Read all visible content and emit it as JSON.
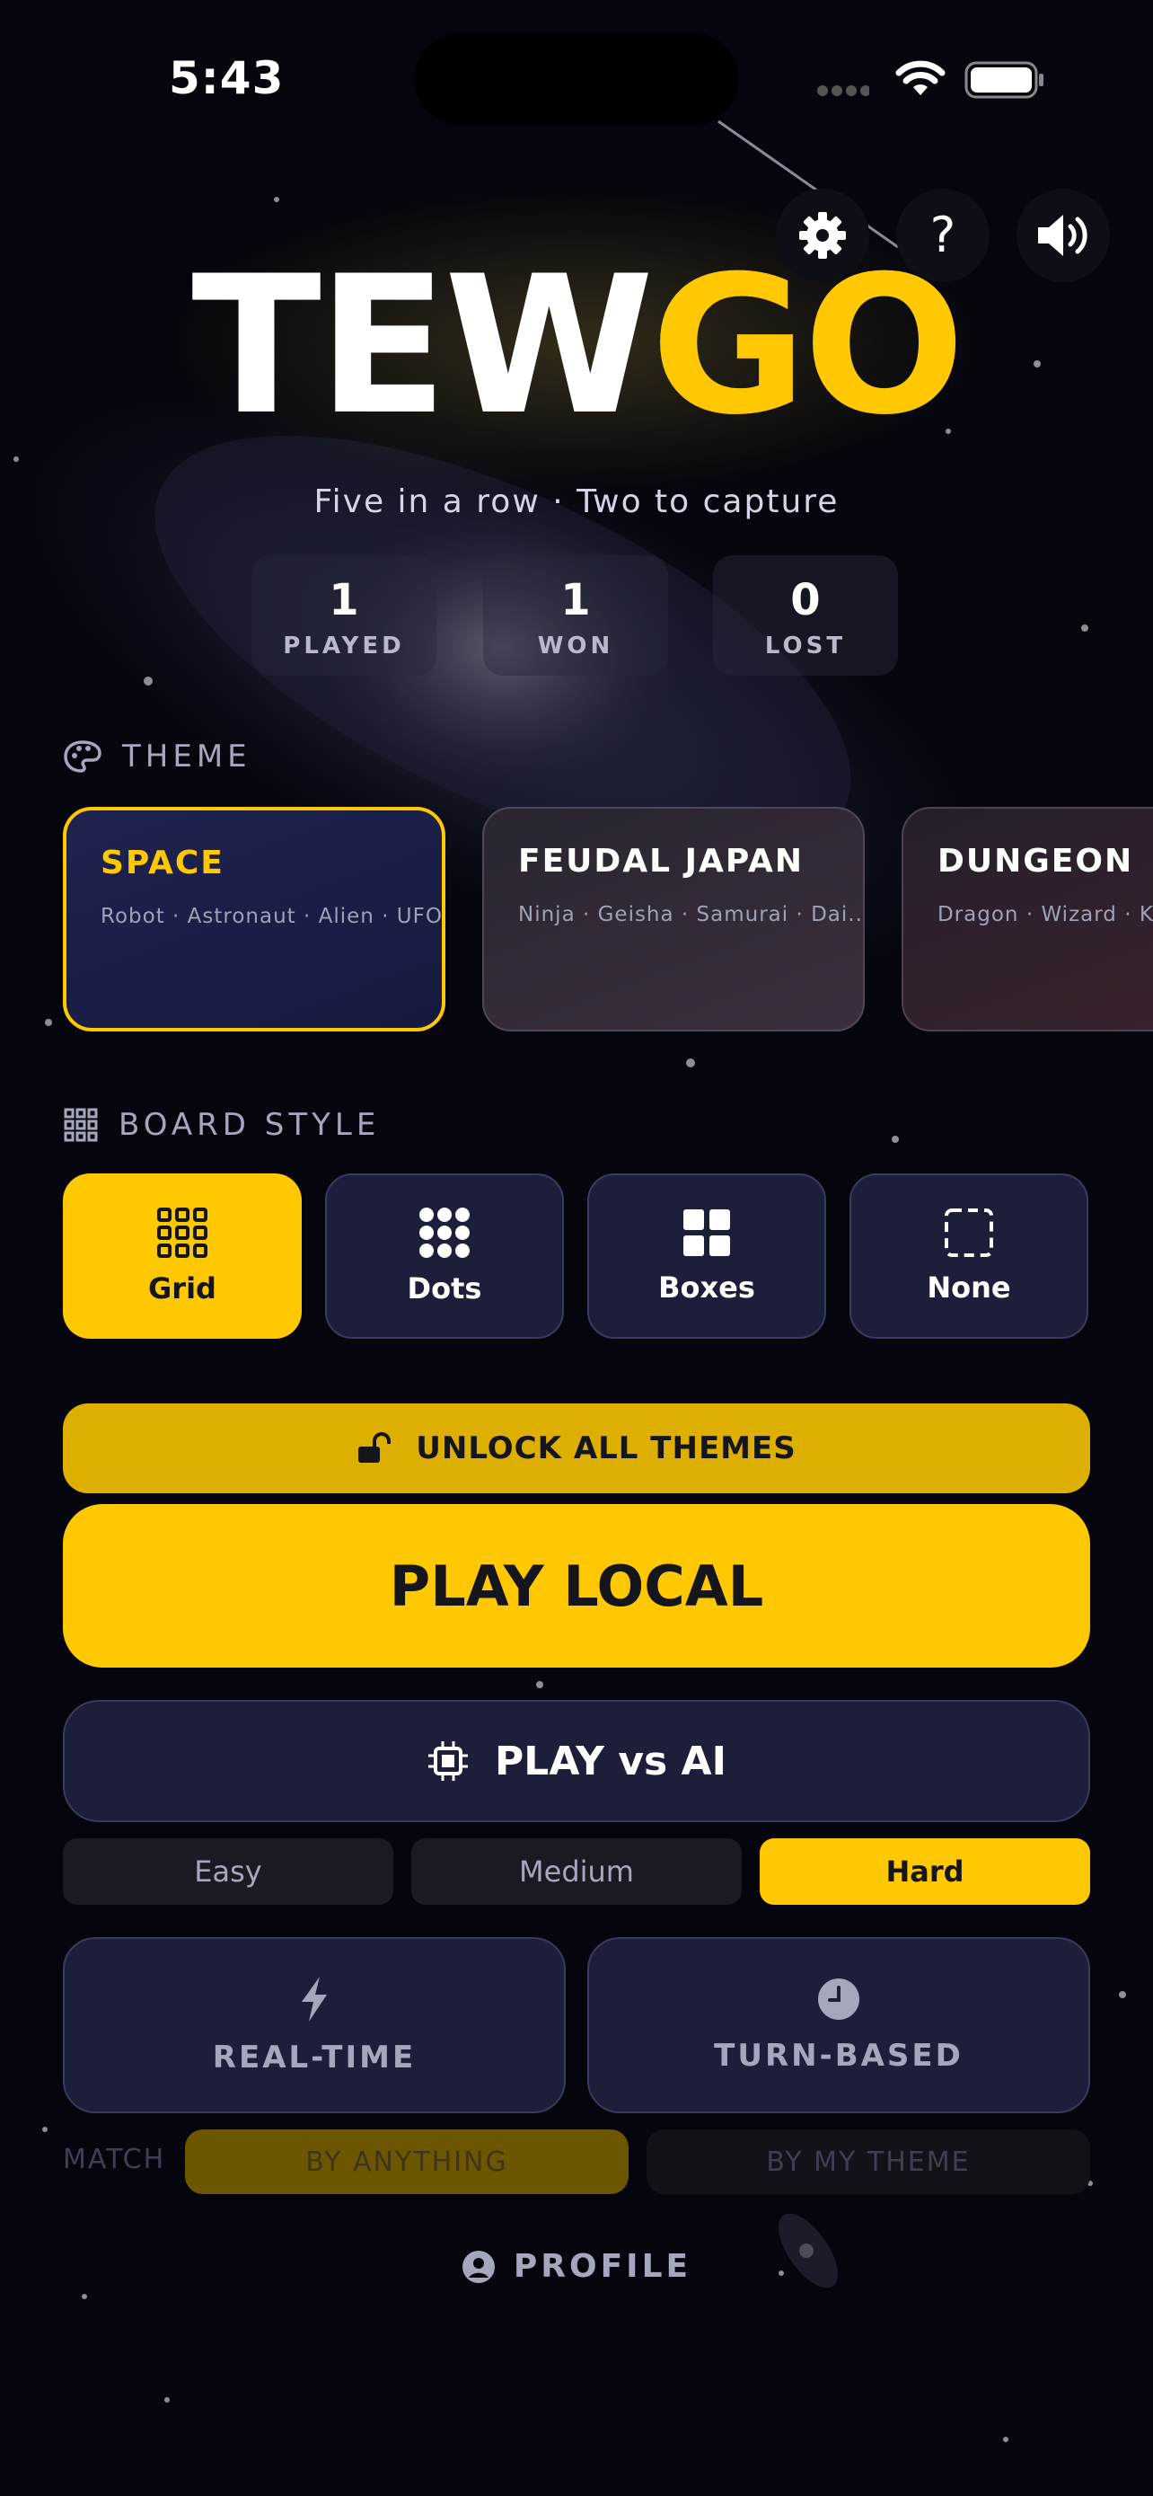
{
  "status_bar": {
    "time": "5:43"
  },
  "header": {
    "title_part1": "TEW",
    "title_part2": "GO",
    "subtitle": "Five in a row  ·  Two to capture",
    "icons": [
      "gear-icon",
      "help-icon",
      "speaker-icon"
    ]
  },
  "stats": [
    {
      "value": "1",
      "label": "PLAYED"
    },
    {
      "value": "1",
      "label": "WON"
    },
    {
      "value": "0",
      "label": "LOST"
    }
  ],
  "theme_section": {
    "label": "THEME",
    "cards": [
      {
        "name": "SPACE",
        "items": "Robot · Astronaut · Alien · UFO",
        "selected": true
      },
      {
        "name": "FEUDAL JAPAN",
        "items": "Ninja · Geisha · Samurai · Dai...",
        "selected": false
      },
      {
        "name": "DUNGEON",
        "items": "Dragon · Wizard · Kni",
        "selected": false
      }
    ]
  },
  "board_style": {
    "label": "BOARD STYLE",
    "options": [
      {
        "label": "Grid",
        "selected": true
      },
      {
        "label": "Dots",
        "selected": false
      },
      {
        "label": "Boxes",
        "selected": false
      },
      {
        "label": "None",
        "selected": false
      }
    ]
  },
  "actions": {
    "unlock_label": "UNLOCK ALL THEMES",
    "play_local_label": "PLAY LOCAL",
    "play_ai_label": "PLAY vs AI"
  },
  "difficulty": {
    "options": [
      "Easy",
      "Medium",
      "Hard"
    ],
    "selected": "Hard"
  },
  "modes": [
    {
      "label": "REAL-TIME",
      "icon": "lightning-icon"
    },
    {
      "label": "TURN-BASED",
      "icon": "clock-icon"
    }
  ],
  "match": {
    "label": "MATCH",
    "options": [
      "BY ANYTHING",
      "BY MY THEME"
    ],
    "selected": "BY ANYTHING"
  },
  "profile": {
    "label": "PROFILE"
  },
  "colors": {
    "accent": "#ffc800",
    "panel": "#1c1e3a",
    "background": "#05060d"
  }
}
